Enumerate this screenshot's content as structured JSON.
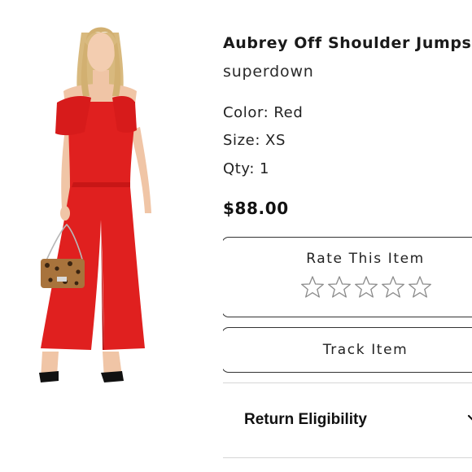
{
  "product": {
    "name": "Aubrey Off Shoulder Jumpsuit",
    "brand": "superdown",
    "color_label": "Color:",
    "color_value": "Red",
    "size_label": "Size:",
    "size_value": "XS",
    "qty_label": "Qty:",
    "qty_value": "1",
    "price": "$88.00",
    "photo_icon": "red-off-shoulder-jumpsuit-photo"
  },
  "rating": {
    "title": "Rate This Item",
    "star_count": 5,
    "filled_stars": 0
  },
  "actions": {
    "track_label": "Track Item"
  },
  "return_section": {
    "label": "Return Eligibility",
    "icon": "chevron-down-icon"
  },
  "colors": {
    "jumpsuit": "#e0201f",
    "border": "#333333"
  }
}
